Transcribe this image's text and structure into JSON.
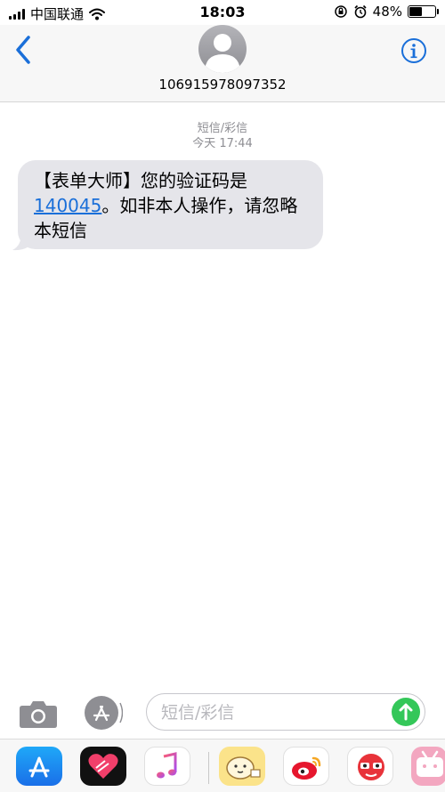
{
  "status_bar": {
    "carrier": "中国联通",
    "time": "18:03",
    "battery": "48%",
    "battery_level": 0.48
  },
  "header": {
    "sender_number": "106915978097352",
    "back_icon": "chevron-left-icon",
    "info_icon": "info-circle-icon"
  },
  "thread": {
    "message_type": "短信/彩信",
    "timestamp": "今天 17:44",
    "message": {
      "part1": "【表单大师】您的验证码是",
      "code": "140045",
      "part2": "。如非本人操作，请忽略本短信"
    }
  },
  "composer": {
    "placeholder": "短信/彩信",
    "camera_icon": "camera-icon",
    "apps_icon": "app-store-icon",
    "send_icon": "arrow-up-icon"
  },
  "app_drawer": {
    "apps": [
      "app-store",
      "digital-touch",
      "music",
      "sticker",
      "weibo",
      "red-face",
      "bilibili"
    ]
  },
  "colors": {
    "accent": "#1a6fd9",
    "bubble": "#e5e5ea",
    "send": "#34c759",
    "meta": "#8e8e93"
  }
}
